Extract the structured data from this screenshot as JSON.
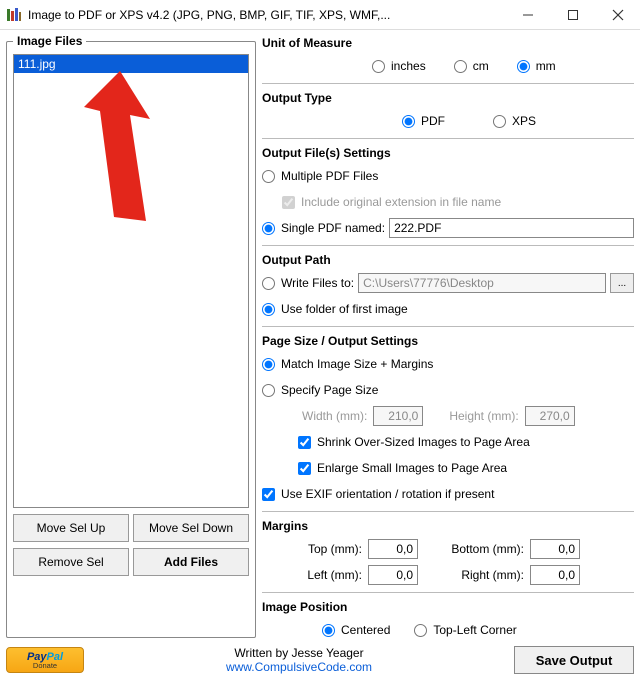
{
  "titlebar": {
    "title": "Image to PDF or XPS  v4.2   (JPG, PNG, BMP, GIF, TIF, XPS, WMF,..."
  },
  "left": {
    "legend": "Image Files",
    "files": [
      "111.jpg"
    ],
    "move_up": "Move Sel Up",
    "move_down": "Move Sel Down",
    "remove": "Remove Sel",
    "add": "Add Files"
  },
  "unit": {
    "legend": "Unit of Measure",
    "inches": "inches",
    "cm": "cm",
    "mm": "mm"
  },
  "output_type": {
    "legend": "Output Type",
    "pdf": "PDF",
    "xps": "XPS"
  },
  "output_files": {
    "legend": "Output File(s) Settings",
    "multiple": "Multiple PDF Files",
    "include_ext": "Include original extension in file name",
    "single_named": "Single PDF named:",
    "single_value": "222.PDF"
  },
  "output_path": {
    "legend": "Output Path",
    "write_to": "Write Files to:",
    "path_value": "C:\\Users\\77776\\Desktop",
    "use_folder": "Use folder of first image"
  },
  "page_size": {
    "legend": "Page Size / Output Settings",
    "match": "Match Image Size + Margins",
    "specify": "Specify Page Size",
    "width_lbl": "Width (mm):",
    "width_val": "210,0",
    "height_lbl": "Height (mm):",
    "height_val": "270,0",
    "shrink": "Shrink Over-Sized Images to Page Area",
    "enlarge": "Enlarge Small Images to Page Area",
    "use_exif": "Use EXIF orientation / rotation if present"
  },
  "margins": {
    "legend": "Margins",
    "top_lbl": "Top (mm):",
    "top_val": "0,0",
    "bottom_lbl": "Bottom (mm):",
    "bottom_val": "0,0",
    "left_lbl": "Left (mm):",
    "left_val": "0,0",
    "right_lbl": "Right (mm):",
    "right_val": "0,0"
  },
  "image_pos": {
    "legend": "Image Position",
    "centered": "Centered",
    "topleft": "Top-Left Corner"
  },
  "footer": {
    "written": "Written by Jesse Yeager",
    "site": "www.CompulsiveCode.com",
    "save": "Save Output"
  }
}
